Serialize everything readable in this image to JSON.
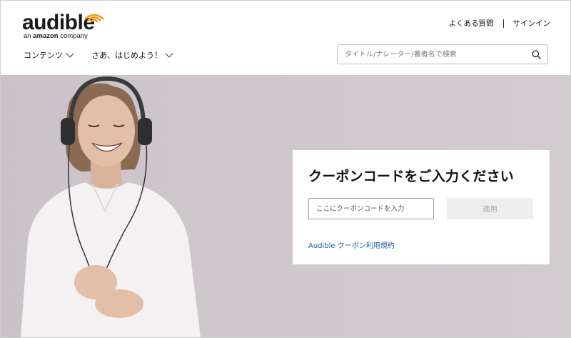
{
  "brand": {
    "name": "audible",
    "sub_prefix": "an ",
    "sub_amazon": "amazon",
    "sub_suffix": " company",
    "accent": "#f7991c"
  },
  "header": {
    "faq_label": "よくある質問",
    "signin_label": "サインイン",
    "nav": [
      {
        "label": "コンテンツ"
      },
      {
        "label": "さあ、はじめよう！"
      }
    ],
    "search": {
      "placeholder": "タイトル/ナレーター/著者名で検索",
      "value": ""
    }
  },
  "coupon": {
    "title": "クーポンコードをご入力ください",
    "input_placeholder": "ここにクーポンコードを入力",
    "input_value": "",
    "apply_label": "適用",
    "terms_link": "Audible クーポン利用規約"
  },
  "icons": {
    "search": "magnifier-icon",
    "chevron": "chevron-down-icon",
    "logo": "audible-signal-icon"
  },
  "colors": {
    "hero_bg": "#cdc7cc",
    "link": "#1f5f9c",
    "apply_bg": "#eeeeee",
    "apply_text": "#a7a7a7"
  }
}
